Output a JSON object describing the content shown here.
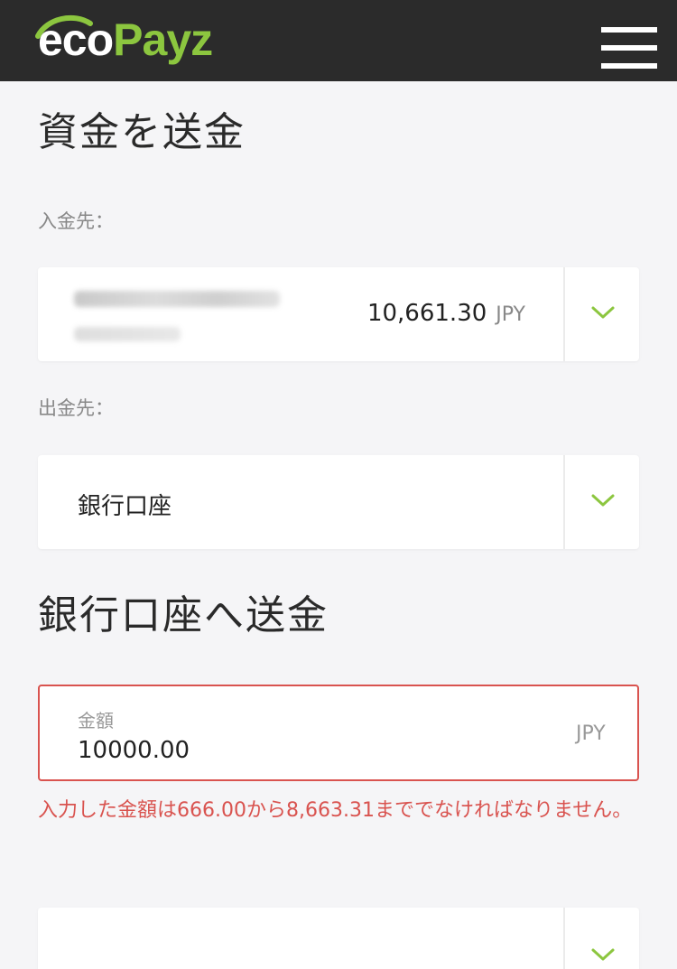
{
  "header": {
    "logo_part1": "eco",
    "logo_part2": "Payz",
    "menu_icon": "hamburger-menu-icon",
    "brand_color": "#8cc63f",
    "bar_color": "#2b2b2b"
  },
  "send_funds": {
    "title": "資金を送金",
    "from_label": "入金先：",
    "from_balance": "10,661.30",
    "from_currency": "JPY",
    "to_label": "出金先：",
    "to_value": "銀行口座"
  },
  "bank_transfer": {
    "title": "銀行口座へ送金",
    "amount_label": "金額",
    "amount_value": "10000.00",
    "amount_currency": "JPY",
    "error_text": "入力した金額は666.00から8,663.31まででなければなりません。",
    "error_color": "#d9534f"
  },
  "icons": {
    "dropdown": "chevron-down-icon"
  }
}
